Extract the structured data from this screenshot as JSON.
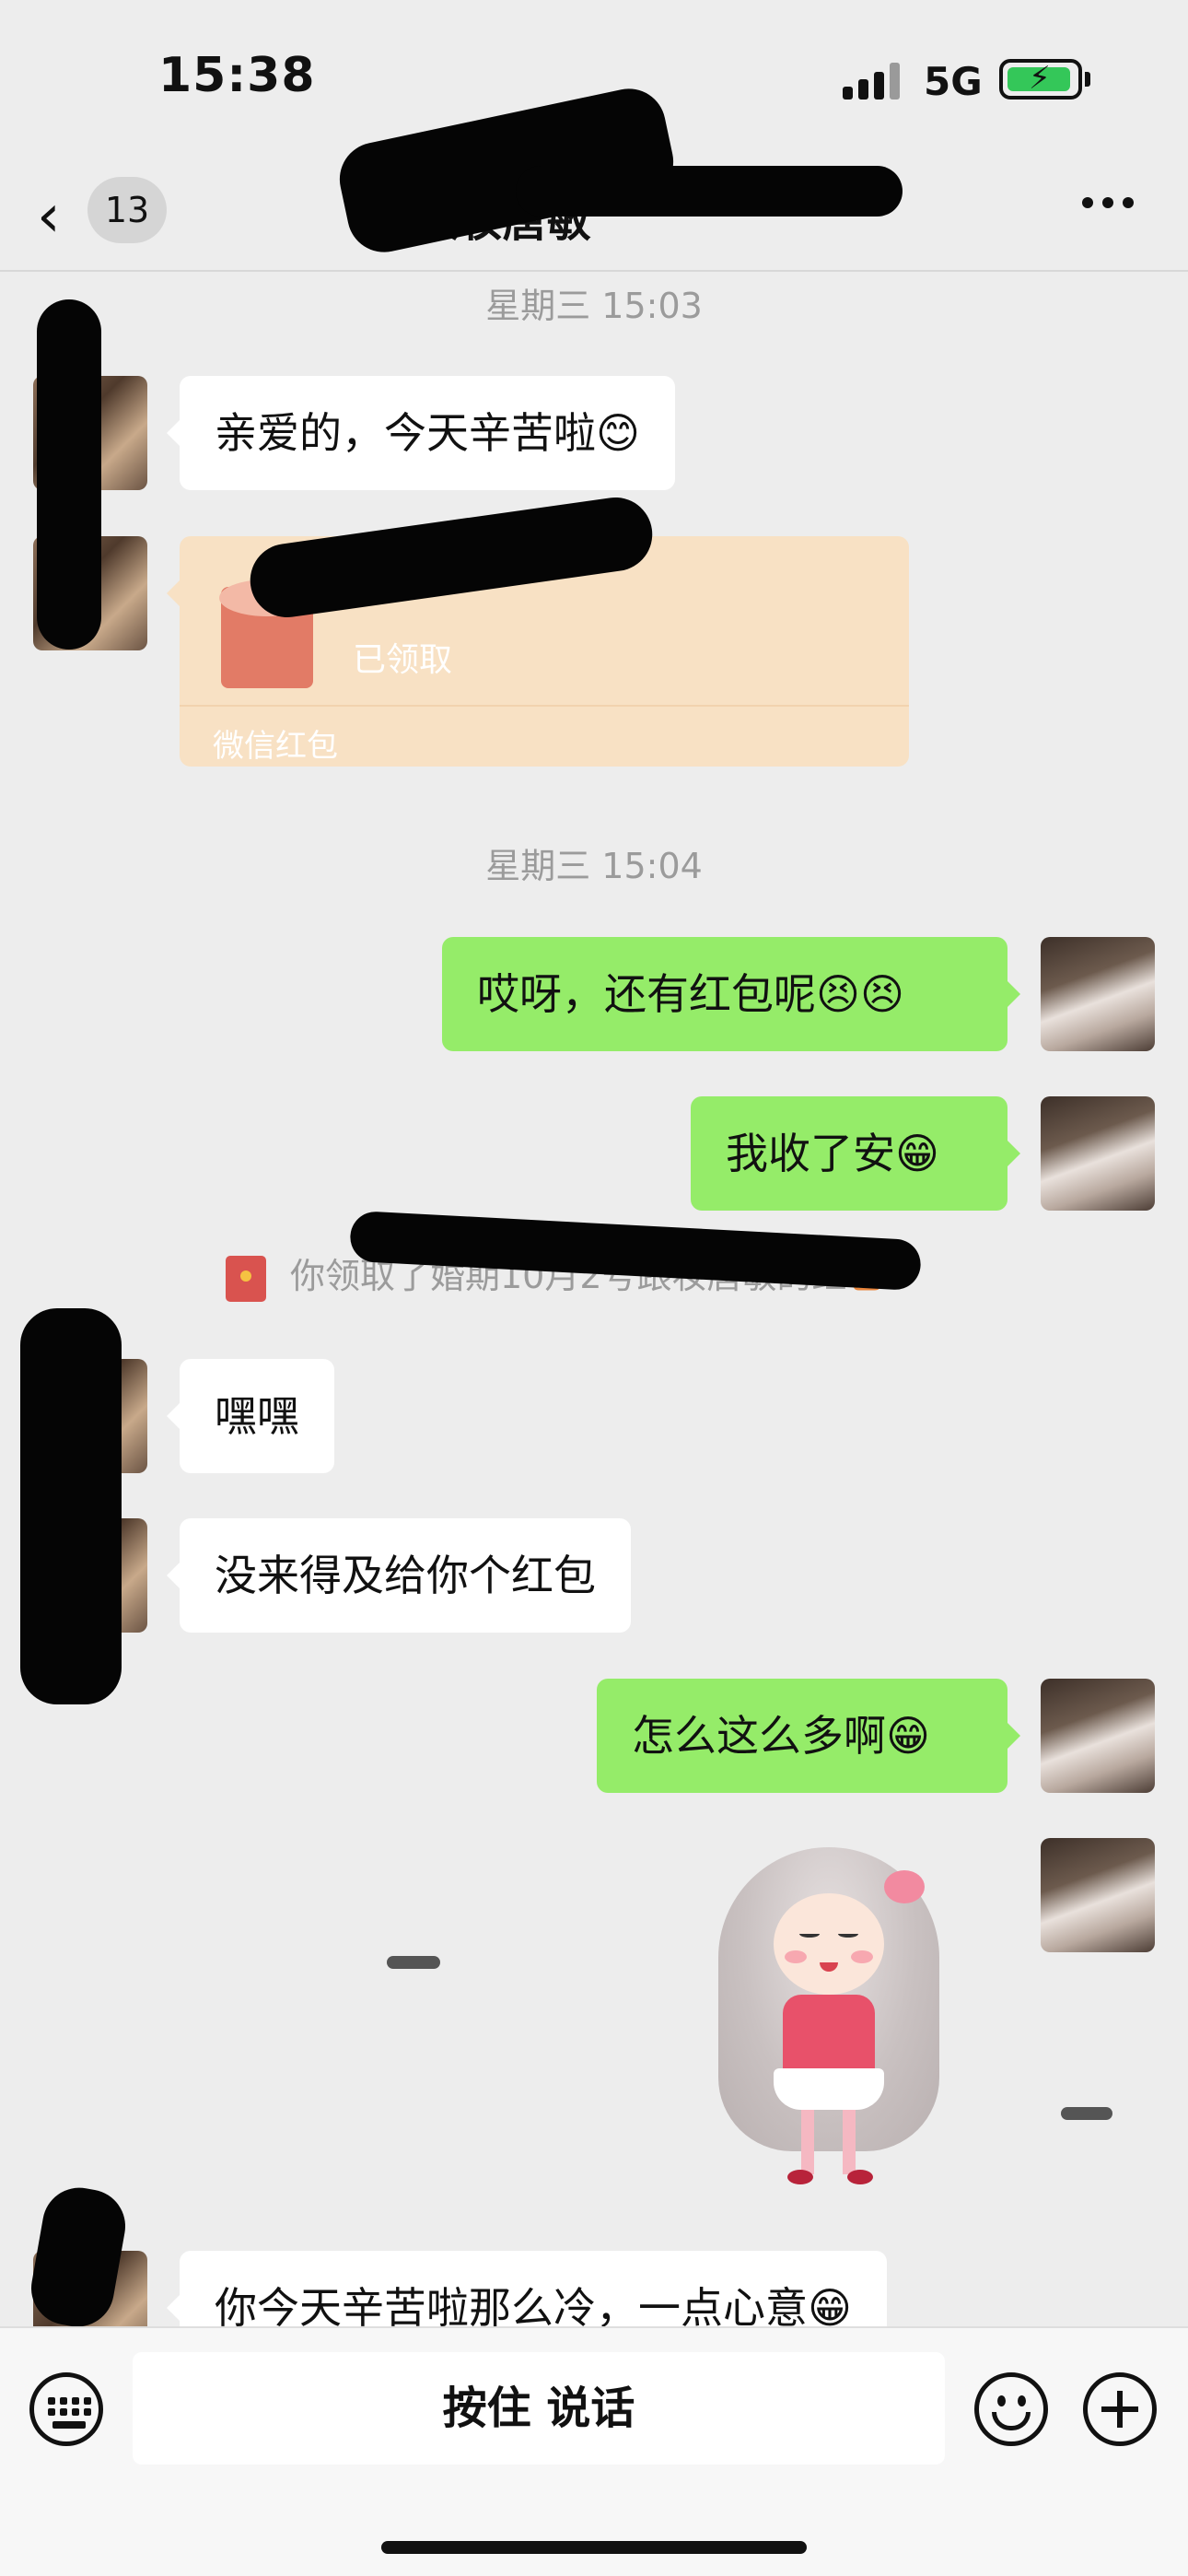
{
  "status_bar": {
    "time": "15:38",
    "network": "5G",
    "icons": [
      "signal-icon",
      "battery-charging-icon"
    ]
  },
  "nav": {
    "back_icon": "chevron-left-icon",
    "unread_count": "13",
    "title": "婚                    跟妆唐敏",
    "more_icon": "more-dots-icon"
  },
  "chat": {
    "timestamps": [
      "星期三 15:03",
      "星期三 15:04"
    ],
    "messages": [
      {
        "side": "left",
        "text": "亲爱的，今天辛苦啦😊"
      },
      {
        "side": "right",
        "text": "哎呀，还有红包呢😣😣"
      },
      {
        "side": "right",
        "text": "我收了安😁"
      },
      {
        "side": "left",
        "text": "嘿嘿"
      },
      {
        "side": "left",
        "text": "没来得及给你个红包"
      },
      {
        "side": "right",
        "text": "怎么这么多啊😁"
      },
      {
        "side": "left",
        "text": "你今天辛苦啦那么冷，一点心意😁"
      }
    ],
    "red_packet": {
      "status": "已领取",
      "footer": "微信红包"
    },
    "system_notice": {
      "text_main": "你领取了婚期10月2号跟妆唐敏的红",
      "text_link": "包"
    },
    "sticker": "cartoon-girl-sticker"
  },
  "input_bar": {
    "talk_label": "按住 说话",
    "icons": [
      "keyboard-icon",
      "emoji-icon",
      "plus-icon"
    ]
  },
  "colors": {
    "background": "#ededed",
    "outgoing_bubble": "#95ec69",
    "incoming_bubble": "#ffffff",
    "red_packet": "#f8e1c4",
    "timestamp_text": "#9b9b9b",
    "link_text": "#e8843a"
  }
}
